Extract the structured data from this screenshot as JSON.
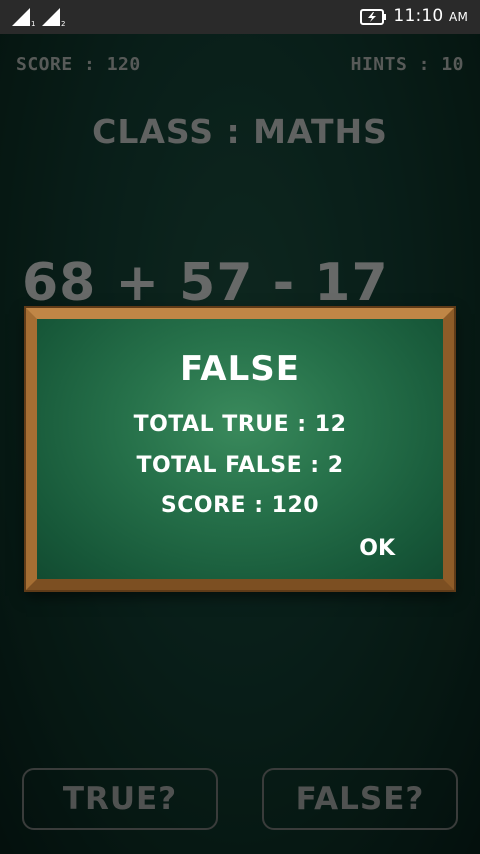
{
  "status_bar": {
    "time": "11:10",
    "ampm": "AM",
    "sim1_label": "1",
    "sim2_label": "2"
  },
  "game": {
    "score_label": "SCORE : 120",
    "hints_label": "HINTS : 10",
    "class_title": "CLASS : MATHS",
    "equation": "68 + 57 - 17"
  },
  "dialog": {
    "title": "FALSE",
    "total_true": "TOTAL TRUE : 12",
    "total_false": "TOTAL FALSE : 2",
    "score": "SCORE : 120",
    "ok_label": "OK"
  },
  "buttons": {
    "true_label": "TRUE?",
    "false_label": "FALSE?"
  }
}
